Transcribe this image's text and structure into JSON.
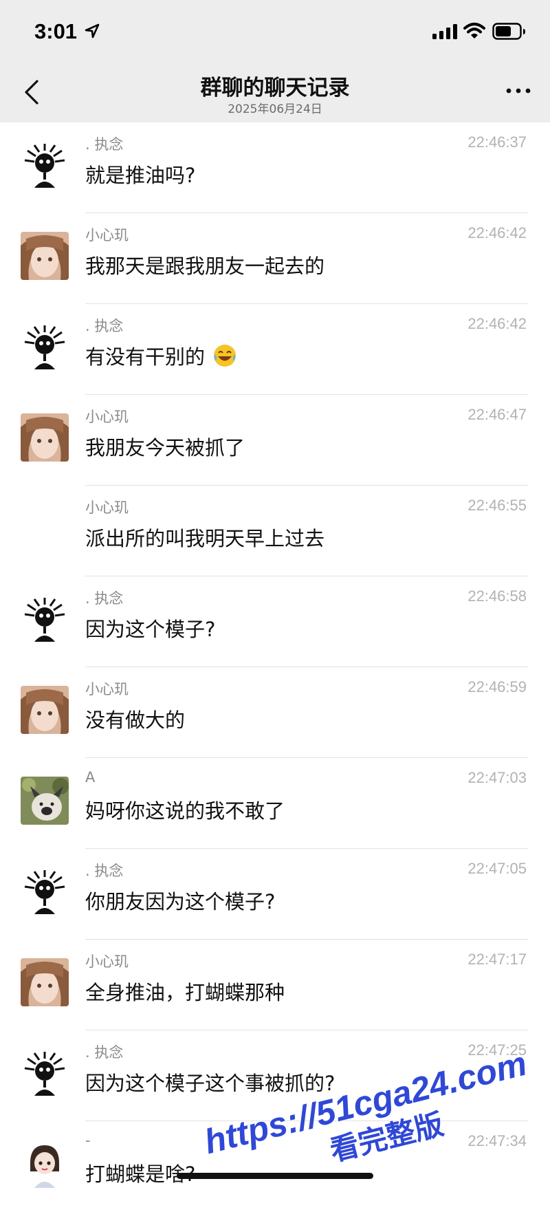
{
  "status_bar": {
    "time": "3:01",
    "icons": [
      "location-arrow-icon",
      "cellular-signal-icon",
      "wifi-icon",
      "battery-icon"
    ]
  },
  "header": {
    "back_icon": "chevron-left-icon",
    "title": "群聊的聊天记录",
    "subtitle": "2025年06月24日",
    "more_icon": "more-dots-icon"
  },
  "messages": [
    {
      "sender": ". 执念",
      "time": "22:46:37",
      "text": "就是推油吗?",
      "avatar": "spiky-doodle"
    },
    {
      "sender": "小心玑",
      "time": "22:46:42",
      "text": "我那天是跟我朋友一起去的",
      "avatar": "anime-girl"
    },
    {
      "sender": ". 执念",
      "time": "22:46:42",
      "text": "有没有干别的",
      "emoji": "laughing-tears-emoji",
      "avatar": "spiky-doodle"
    },
    {
      "sender": "小心玑",
      "time": "22:46:47",
      "text": "我朋友今天被抓了",
      "avatar": "anime-girl"
    },
    {
      "sender": "小心玑",
      "time": "22:46:55",
      "text": "派出所的叫我明天早上过去",
      "avatar": ""
    },
    {
      "sender": ". 执念",
      "time": "22:46:58",
      "text": "因为这个模子?",
      "avatar": "spiky-doodle"
    },
    {
      "sender": "小心玑",
      "time": "22:46:59",
      "text": "没有做大的",
      "avatar": "anime-girl"
    },
    {
      "sender": "A",
      "time": "22:47:03",
      "text": "妈呀你这说的我不敢了",
      "avatar": "dog-photo"
    },
    {
      "sender": ". 执念",
      "time": "22:47:05",
      "text": "你朋友因为这个模子?",
      "avatar": "spiky-doodle"
    },
    {
      "sender": "小心玑",
      "time": "22:47:17",
      "text": "全身推油，打蝴蝶那种",
      "avatar": "anime-girl"
    },
    {
      "sender": ". 执念",
      "time": "22:47:25",
      "text": "因为这个模子这个事被抓的?",
      "avatar": "spiky-doodle"
    },
    {
      "sender": "-",
      "time": "22:47:34",
      "text": "打蝴蝶是啥?",
      "avatar": "cartoon-girl"
    }
  ],
  "watermark": {
    "line1": "https://51cga24.com",
    "line2": "看完整版",
    "color": "#2f48d6"
  }
}
